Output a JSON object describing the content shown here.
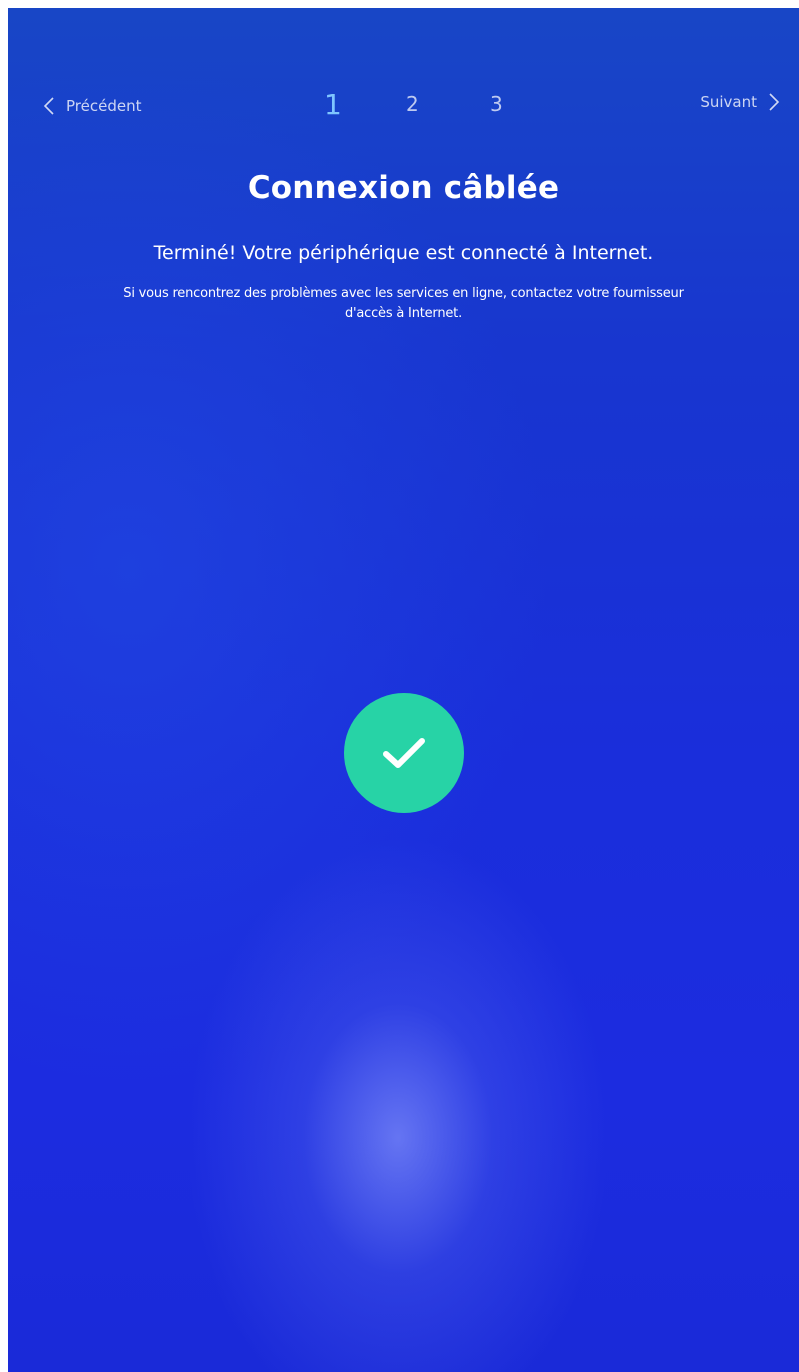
{
  "nav": {
    "prev_label": "Précédent",
    "next_label": "Suivant",
    "prev_icon": "chevron-left-icon",
    "next_icon": "chevron-right-icon"
  },
  "steps": [
    {
      "label": "1",
      "active": true
    },
    {
      "label": "2",
      "active": false
    },
    {
      "label": "3",
      "active": false
    }
  ],
  "content": {
    "title": "Connexion câblée",
    "subtitle": "Terminé! Votre périphérique est connecté à Internet.",
    "note_line1": "Si vous rencontrez des problèmes avec les services en ligne, contactez votre fournisseur",
    "note_line2": "d'accès à Internet."
  },
  "status_icon": "checkmark-icon",
  "colors": {
    "background": "#1a32d6",
    "accent_active_step": "#7fc6ff",
    "success": "#27d3a6",
    "text": "#ffffff"
  }
}
